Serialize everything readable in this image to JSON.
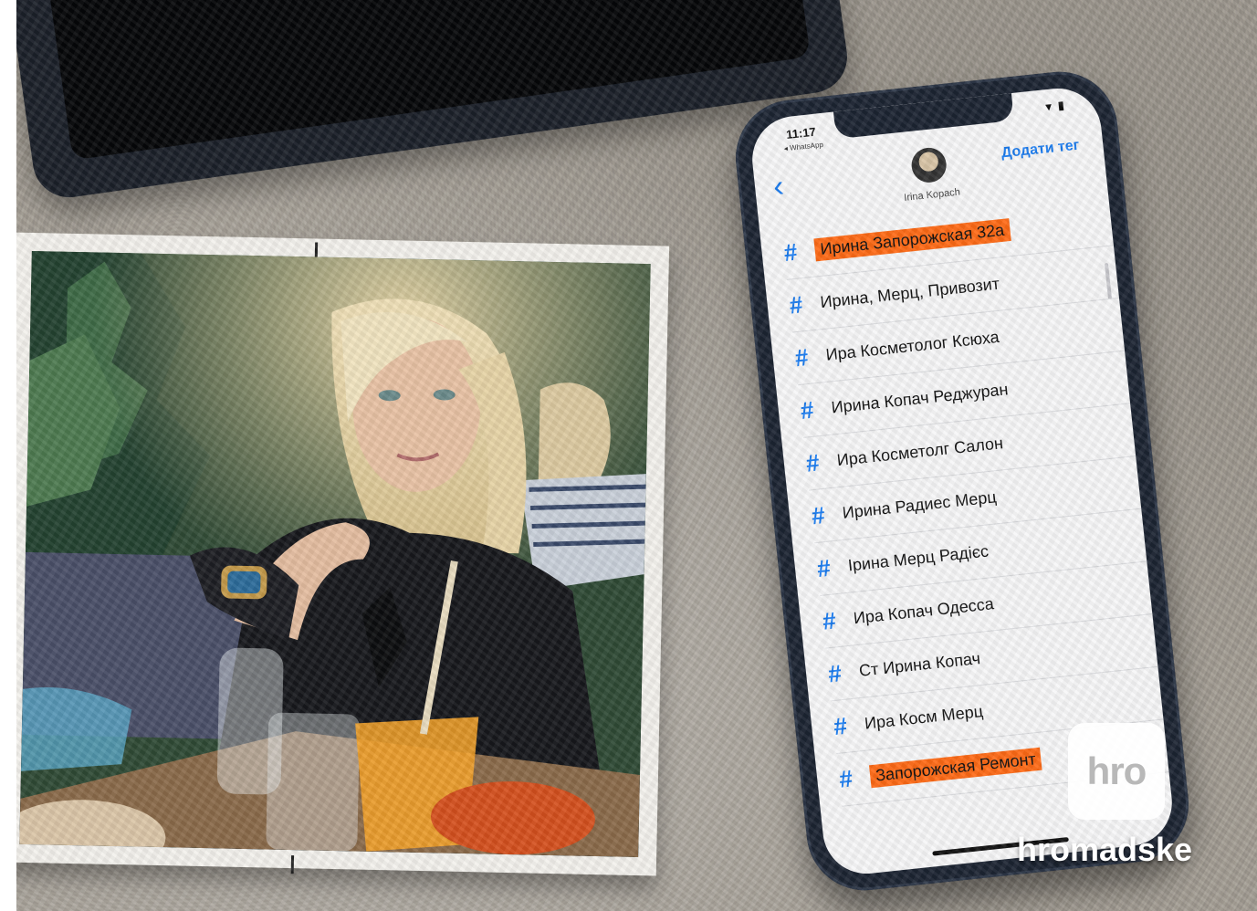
{
  "phone": {
    "status_time": "11:17",
    "status_app": "◂ WhatsApp",
    "status_icons": "▾ ▮",
    "contact_name": "Irina Kopach",
    "add_tag_label": "Додати тег",
    "tags": [
      {
        "label": "Ирина Запорожская 32а",
        "highlighted": true
      },
      {
        "label": "Ирина, Мерц, Привозит",
        "highlighted": false
      },
      {
        "label": "Ира Косметолог Ксюха",
        "highlighted": false
      },
      {
        "label": "Ирина Копач Реджуран",
        "highlighted": false
      },
      {
        "label": "Ира Косметолг Салон",
        "highlighted": false
      },
      {
        "label": "Ирина Радиес Мерц",
        "highlighted": false
      },
      {
        "label": "Ірина Мерц Радієс",
        "highlighted": false
      },
      {
        "label": "Ира Копач Одесса",
        "highlighted": false
      },
      {
        "label": "Ст Ирина Копач",
        "highlighted": false
      },
      {
        "label": "Ира Косм Мерц",
        "highlighted": false
      },
      {
        "label": "Запорожская Ремонт",
        "highlighted": true
      }
    ],
    "hash_symbol": "#"
  },
  "watermark": {
    "logo": "hro",
    "brand": "hromadske"
  },
  "colors": {
    "accent": "#1a7cf0",
    "highlight": "#ff6a16",
    "phone_frame": "#1c2432"
  }
}
